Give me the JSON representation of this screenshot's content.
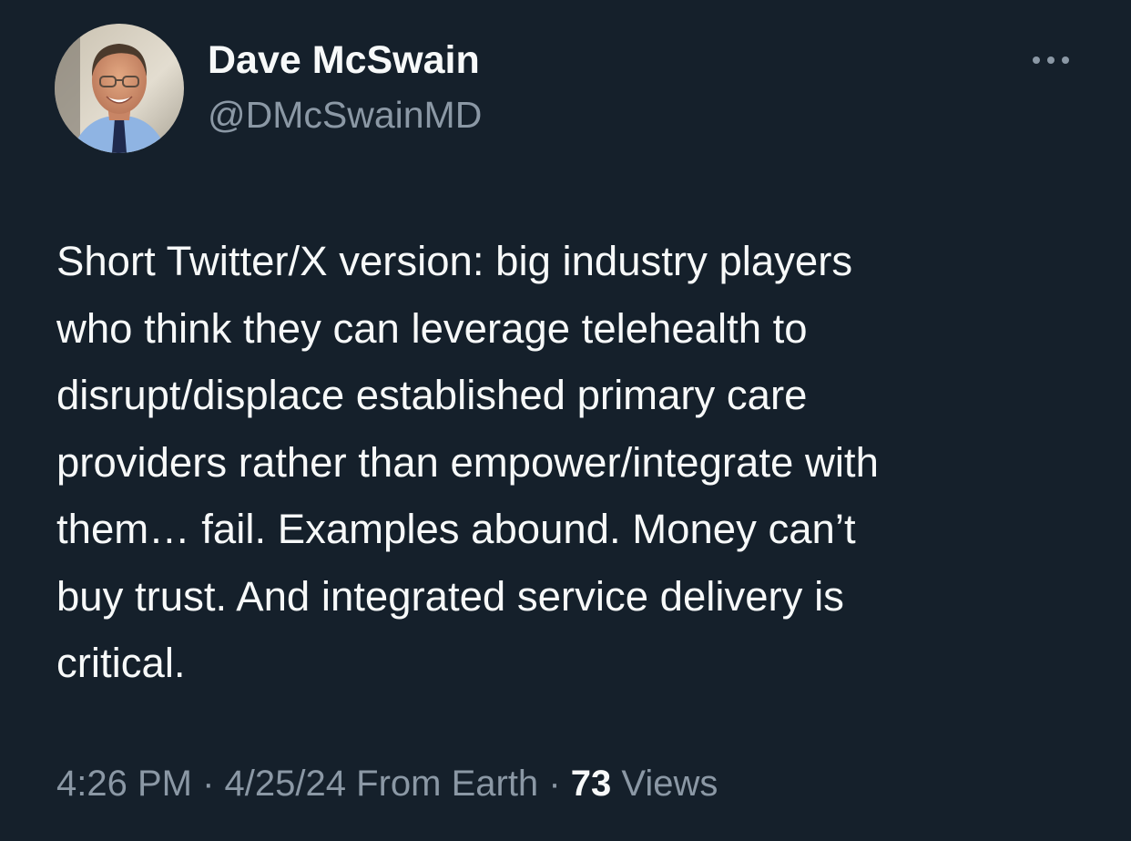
{
  "author": {
    "display_name": "Dave McSwain",
    "handle": "@DMcSwainMD",
    "avatar_icon": "profile-photo"
  },
  "more_button": {
    "icon": "more-horizontal-icon"
  },
  "tweet": {
    "lines": [
      "Short Twitter/X version: big industry players",
      "who think they can leverage telehealth to",
      "disrupt/displace established primary care",
      "providers rather than empower/integrate with",
      "them… fail. Examples abound. Money can’t",
      "buy trust. And integrated service delivery is",
      "critical."
    ]
  },
  "meta": {
    "time": "4:26 PM",
    "separator": "·",
    "date": "4/25/24",
    "source": "From Earth",
    "views_count": "73",
    "views_label": "Views"
  },
  "colors": {
    "background": "#15202b",
    "primary_text": "#f7f9f9",
    "secondary_text": "#8b98a5"
  }
}
